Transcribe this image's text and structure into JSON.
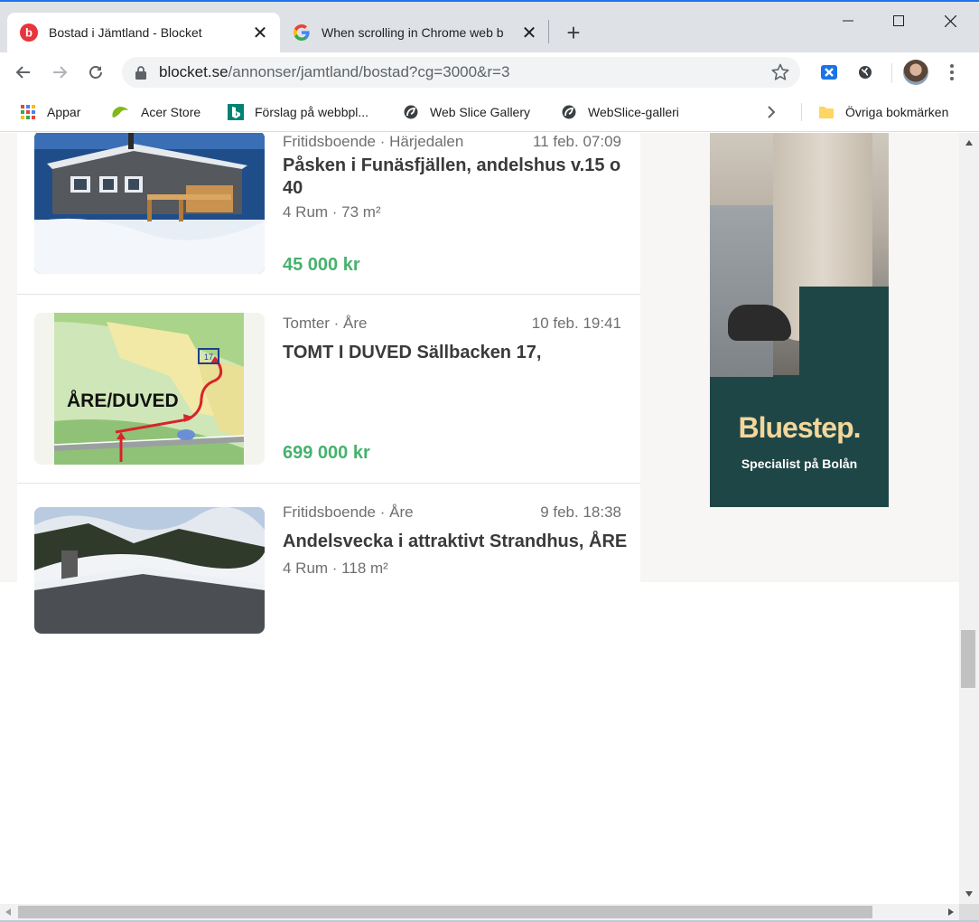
{
  "tabs": [
    {
      "title": "Bostad i Jämtland - Blocket",
      "active": true
    },
    {
      "title": "When scrolling in Chrome web b",
      "active": false
    }
  ],
  "address": {
    "host": "blocket.se",
    "path": "/annonser/jamtland/bostad?cg=3000&r=3"
  },
  "bookmarks": [
    {
      "label": "Appar"
    },
    {
      "label": "Acer Store"
    },
    {
      "label": "Förslag på webbpl..."
    },
    {
      "label": "Web Slice Gallery"
    },
    {
      "label": "WebSlice-galleri"
    },
    {
      "label": "Övriga bokmärken"
    }
  ],
  "listings": [
    {
      "category": "Fritidsboende · Härjedalen",
      "date": "11 feb. 07:09",
      "title": "Påsken i Funäsfjällen, andelshus v.15 o 40",
      "details": "4 Rum · 73 m²",
      "price": "45 000 kr"
    },
    {
      "category": "Tomter · Åre",
      "date": "10 feb. 19:41",
      "title": "TOMT I DUVED Sällbacken 17,",
      "details": "",
      "price": "699 000 kr",
      "image_label": "ÅRE/DUVED",
      "lot_number": "17"
    },
    {
      "category": "Fritidsboende · Åre",
      "date": "9 feb. 18:38",
      "title": "Andelsvecka i attraktivt Strandhus, ÅRE",
      "details": "4 Rum · 118 m²",
      "price": ""
    }
  ],
  "ad": {
    "brand": "Bluestep.",
    "tagline": "Specialist på Bolån",
    "background_color": "#1f4647",
    "brand_color": "#f3d69b"
  },
  "colors": {
    "price": "#46b26c",
    "accent": "#1a73e8",
    "tab_strip": "#dee1e6"
  }
}
